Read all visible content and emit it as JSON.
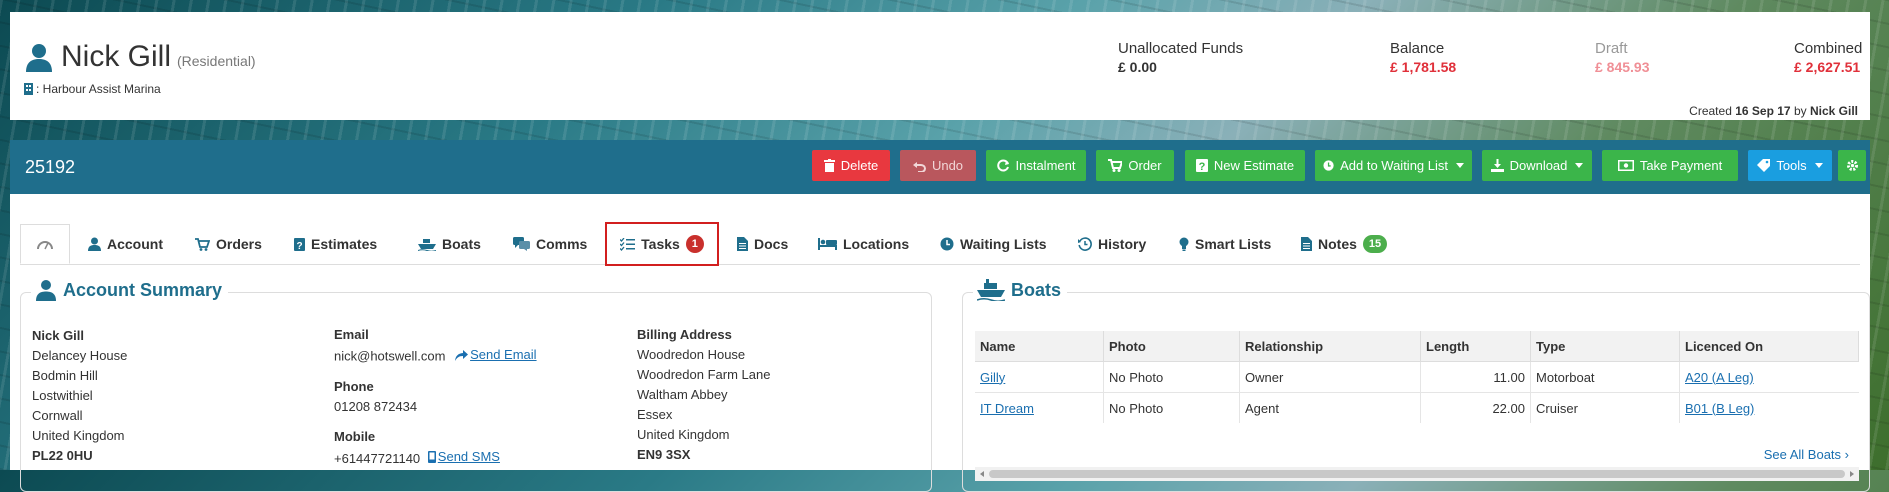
{
  "header": {
    "name": "Nick Gill",
    "type": "(Residential)",
    "marina": ": Harbour Assist Marina",
    "funds": [
      {
        "label": "Unallocated Funds",
        "value": "£ 0.00",
        "color": "#333333"
      },
      {
        "label": "Balance",
        "value": "£ 1,781.58",
        "color": "#e0303a"
      },
      {
        "label": "Draft",
        "value": "£ 845.93",
        "color": "#f08f96"
      },
      {
        "label": "Combined",
        "value": "£ 2,627.51",
        "color": "#e0303a"
      }
    ],
    "created_prefix": "Created",
    "created_date": "16 Sep 17",
    "created_by_word": "by",
    "created_by": "Nick Gill"
  },
  "toolbar": {
    "record_id": "25192",
    "buttons": {
      "delete": "Delete",
      "undo": "Undo",
      "instalment": "Instalment",
      "order": "Order",
      "new_estimate": "New Estimate",
      "waiting_list": "Add to Waiting List",
      "download": "Download",
      "take_payment": "Take Payment",
      "tools": "Tools"
    }
  },
  "tabs": {
    "dashboard_icon": "dashboard-icon",
    "account": "Account",
    "orders": "Orders",
    "estimates": "Estimates",
    "boats": "Boats",
    "comms": "Comms",
    "tasks": "Tasks",
    "tasks_count": "1",
    "docs": "Docs",
    "locations": "Locations",
    "waiting_lists": "Waiting Lists",
    "history": "History",
    "smart_lists": "Smart Lists",
    "notes": "Notes",
    "notes_count": "15"
  },
  "account_summary": {
    "title": "Account Summary",
    "address": {
      "name": "Nick Gill",
      "line1": "Delancey House",
      "line2": "Bodmin Hill",
      "line3": "Lostwithiel",
      "line4": "Cornwall",
      "line5": "United Kingdom",
      "postcode": "PL22 0HU"
    },
    "email_label": "Email",
    "email": "nick@hotswell.com",
    "send_email": "Send Email",
    "phone_label": "Phone",
    "phone": "01208 872434",
    "mobile_label": "Mobile",
    "mobile": "+61447721140",
    "send_sms": "Send SMS",
    "billing": {
      "label": "Billing Address",
      "line1": "Woodredon House",
      "line2": "Woodredon Farm Lane",
      "line3": "Waltham Abbey",
      "line4": "Essex",
      "line5": "United Kingdom",
      "postcode": "EN9 3SX"
    }
  },
  "boats_panel": {
    "title": "Boats",
    "columns": [
      "Name",
      "Photo",
      "Relationship",
      "Length",
      "Type",
      "Licenced On"
    ],
    "rows": [
      {
        "name": "Gilly",
        "photo": "No Photo",
        "relationship": "Owner",
        "length": "11.00",
        "type": "Motorboat",
        "licenced_on": "A20 (A Leg)"
      },
      {
        "name": "IT Dream",
        "photo": "No Photo",
        "relationship": "Agent",
        "length": "22.00",
        "type": "Cruiser",
        "licenced_on": "B01 (B Leg)"
      }
    ],
    "see_all": "See All Boats"
  },
  "colors": {
    "toolbar": "#1f6e8c",
    "accent_blue": "#1a6fb0",
    "danger": "#e8383f",
    "success": "#3bb54a",
    "info": "#1a9ee0",
    "highlight": "#d21f1f"
  }
}
